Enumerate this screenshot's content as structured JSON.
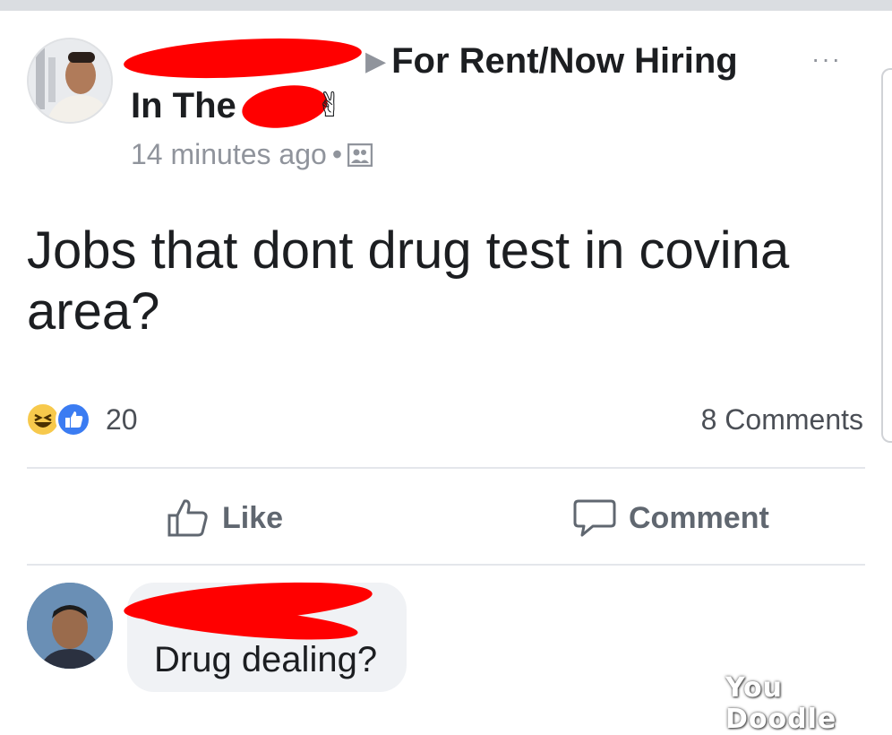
{
  "post": {
    "group_name": "For Rent/Now Hiring",
    "group_name_line2": "In The",
    "peace_emoji": "✌",
    "timestamp": "14 minutes ago",
    "separator": "•",
    "more_label": "···",
    "text": "Jobs that dont drug test in covina area?",
    "reaction_count": "20",
    "comment_count": "8 Comments"
  },
  "actions": {
    "like_label": "Like",
    "comment_label": "Comment"
  },
  "comment": {
    "text": "Drug dealing?"
  },
  "watermark": "You Doodle",
  "colors": {
    "redaction": "#ff0000",
    "like_blue": "#3b7cf2",
    "haha_yellow": "#f7c94c",
    "muted_text": "#90949c"
  },
  "icons": [
    "audience-photo-icon",
    "haha-reaction-icon",
    "like-reaction-icon",
    "thumbs-up-icon",
    "comment-bubble-icon",
    "more-options-icon"
  ]
}
